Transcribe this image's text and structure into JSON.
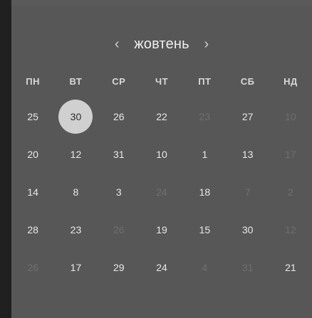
{
  "calendar": {
    "month_label": "жовтень",
    "prev_label": "‹",
    "next_label": "›",
    "weekdays": [
      "ПН",
      "ВТ",
      "СР",
      "ЧТ",
      "ПТ",
      "СБ",
      "НД"
    ],
    "weeks": [
      [
        {
          "v": "25",
          "muted": false
        },
        {
          "v": "30",
          "muted": false,
          "selected": true
        },
        {
          "v": "26",
          "muted": false
        },
        {
          "v": "22",
          "muted": false
        },
        {
          "v": "23",
          "muted": true
        },
        {
          "v": "27",
          "muted": false
        },
        {
          "v": "10",
          "muted": true
        }
      ],
      [
        {
          "v": "20",
          "muted": false
        },
        {
          "v": "12",
          "muted": false
        },
        {
          "v": "31",
          "muted": false
        },
        {
          "v": "10",
          "muted": false
        },
        {
          "v": "1",
          "muted": false
        },
        {
          "v": "13",
          "muted": false
        },
        {
          "v": "17",
          "muted": true
        }
      ],
      [
        {
          "v": "14",
          "muted": false
        },
        {
          "v": "8",
          "muted": false
        },
        {
          "v": "3",
          "muted": false
        },
        {
          "v": "24",
          "muted": true
        },
        {
          "v": "18",
          "muted": false
        },
        {
          "v": "7",
          "muted": true
        },
        {
          "v": "2",
          "muted": true
        }
      ],
      [
        {
          "v": "28",
          "muted": false
        },
        {
          "v": "23",
          "muted": false
        },
        {
          "v": "26",
          "muted": true
        },
        {
          "v": "19",
          "muted": false
        },
        {
          "v": "15",
          "muted": false
        },
        {
          "v": "30",
          "muted": false
        },
        {
          "v": "12",
          "muted": true
        }
      ],
      [
        {
          "v": "26",
          "muted": true
        },
        {
          "v": "17",
          "muted": false
        },
        {
          "v": "29",
          "muted": false
        },
        {
          "v": "24",
          "muted": false
        },
        {
          "v": "4",
          "muted": true
        },
        {
          "v": "31",
          "muted": true
        },
        {
          "v": "21",
          "muted": false
        }
      ]
    ]
  }
}
